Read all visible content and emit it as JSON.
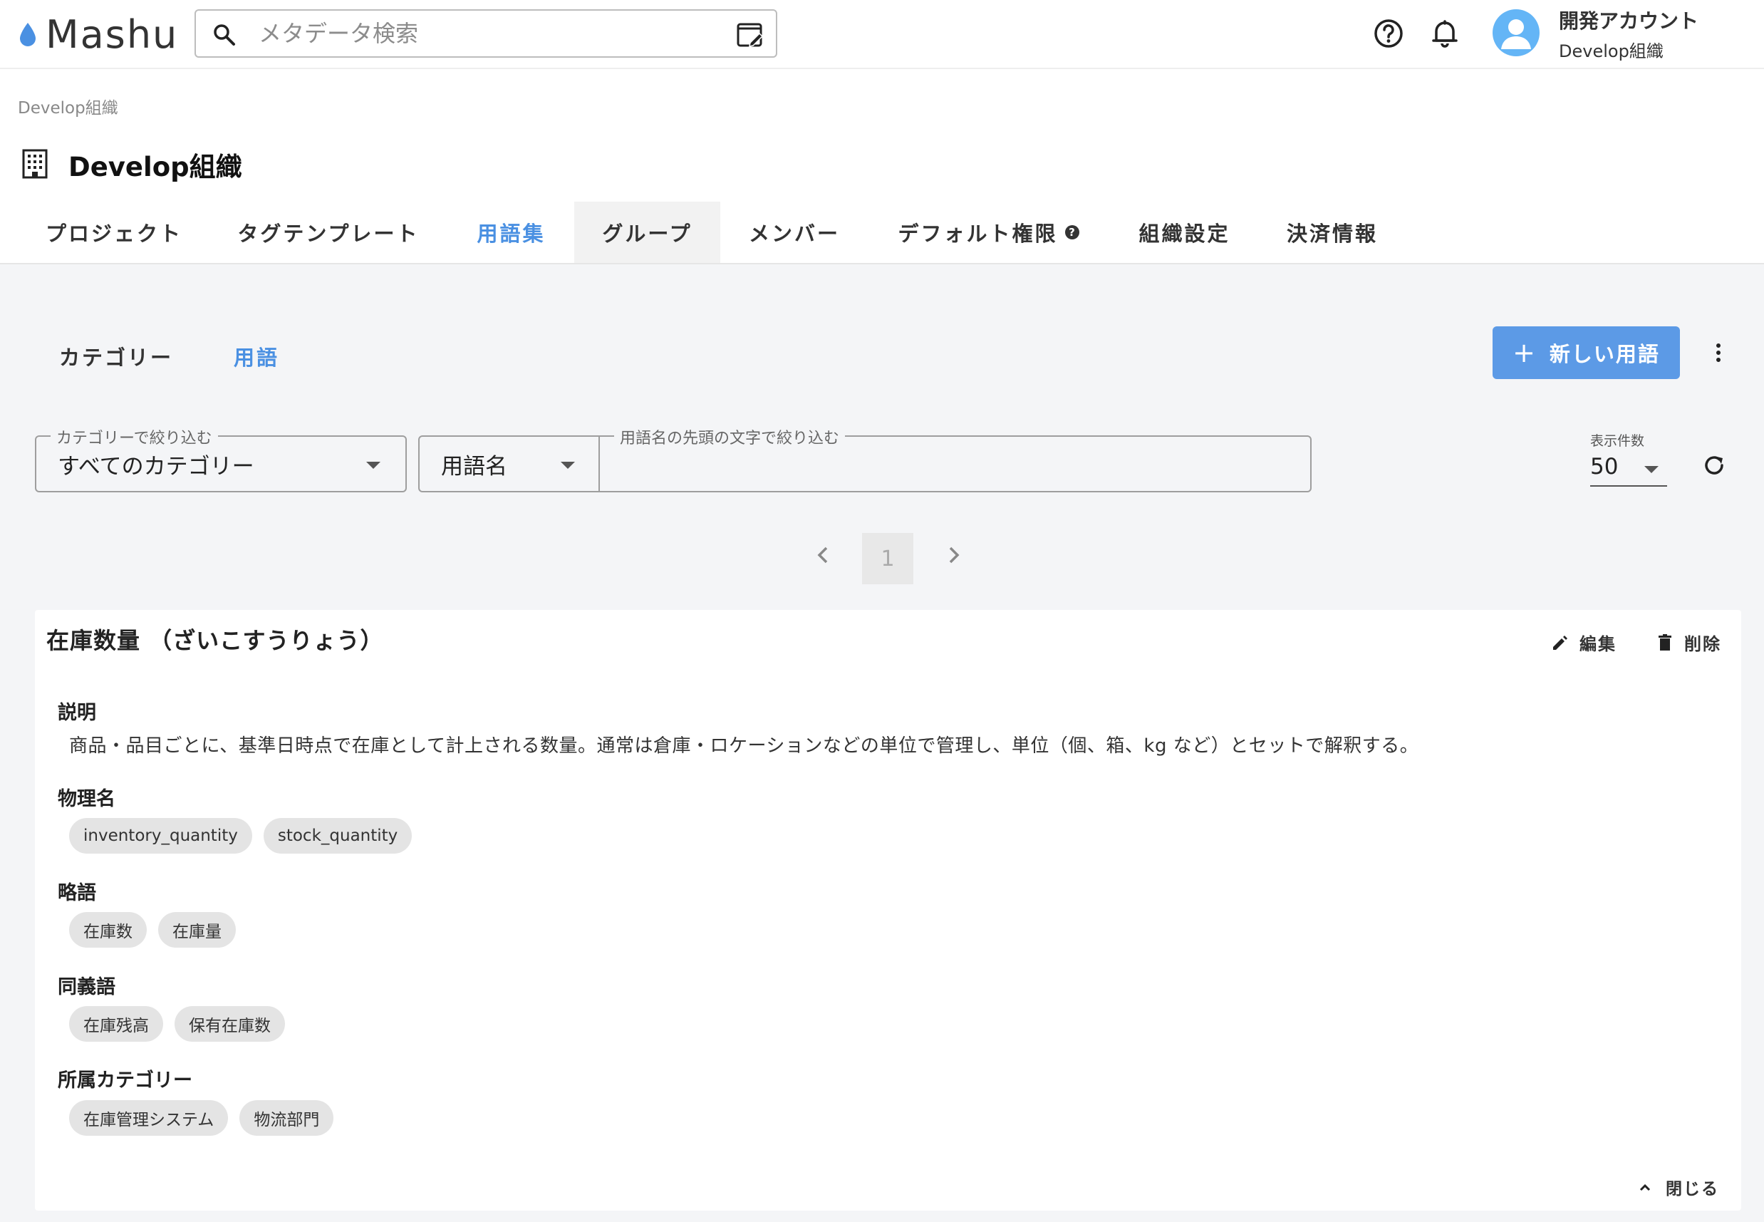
{
  "app": {
    "logo_text": "Mashu"
  },
  "search": {
    "placeholder": "メタデータ検索",
    "value": ""
  },
  "account": {
    "name": "開発アカウント",
    "org": "Develop組織"
  },
  "breadcrumb": "Develop組織",
  "page_title": "Develop組織",
  "tabs": [
    {
      "label": "プロジェクト"
    },
    {
      "label": "タグテンプレート"
    },
    {
      "label": "用語集",
      "active": true
    },
    {
      "label": "グループ"
    },
    {
      "label": "メンバー"
    },
    {
      "label": "デフォルト権限"
    },
    {
      "label": "組織設定"
    },
    {
      "label": "決済情報"
    }
  ],
  "subtabs": [
    {
      "label": "カテゴリー"
    },
    {
      "label": "用語",
      "active": true
    }
  ],
  "new_button_label": "新しい用語",
  "new_button_plus": "+",
  "tab_help_mark": "?",
  "filters": {
    "category_label": "カテゴリーで絞り込む",
    "category_value": "すべてのカテゴリー",
    "field_value": "用語名",
    "prefix_label": "用語名の先頭の文字で絞り込む",
    "prefix_value": "",
    "page_size_label": "表示件数",
    "page_size_value": "50"
  },
  "pagination": {
    "current_page": "1"
  },
  "term": {
    "title": "在庫数量 （ざいこすうりょう）",
    "edit_label": "編集",
    "delete_label": "削除",
    "description_label": "説明",
    "description": "商品・品目ごとに、基準日時点で在庫として計上される数量。通常は倉庫・ロケーションなどの単位で管理し、単位（個、箱、kg など）とセットで解釈する。",
    "physical_names_label": "物理名",
    "physical_names": [
      "inventory_quantity",
      "stock_quantity"
    ],
    "abbreviations_label": "略語",
    "abbreviations": [
      "在庫数",
      "在庫量"
    ],
    "synonyms_label": "同義語",
    "synonyms": [
      "在庫残高",
      "保有在庫数"
    ],
    "categories_label": "所属カテゴリー",
    "categories": [
      "在庫管理システム",
      "物流部門"
    ],
    "close_label": "閉じる"
  },
  "colors": {
    "accent": "#4a90e2",
    "primary_button": "#5c9ae6",
    "avatar": "#64b5f6",
    "drop_icon": "#4a90e2",
    "content_bg": "#f4f5f7",
    "chip_bg": "#e4e4e4"
  }
}
